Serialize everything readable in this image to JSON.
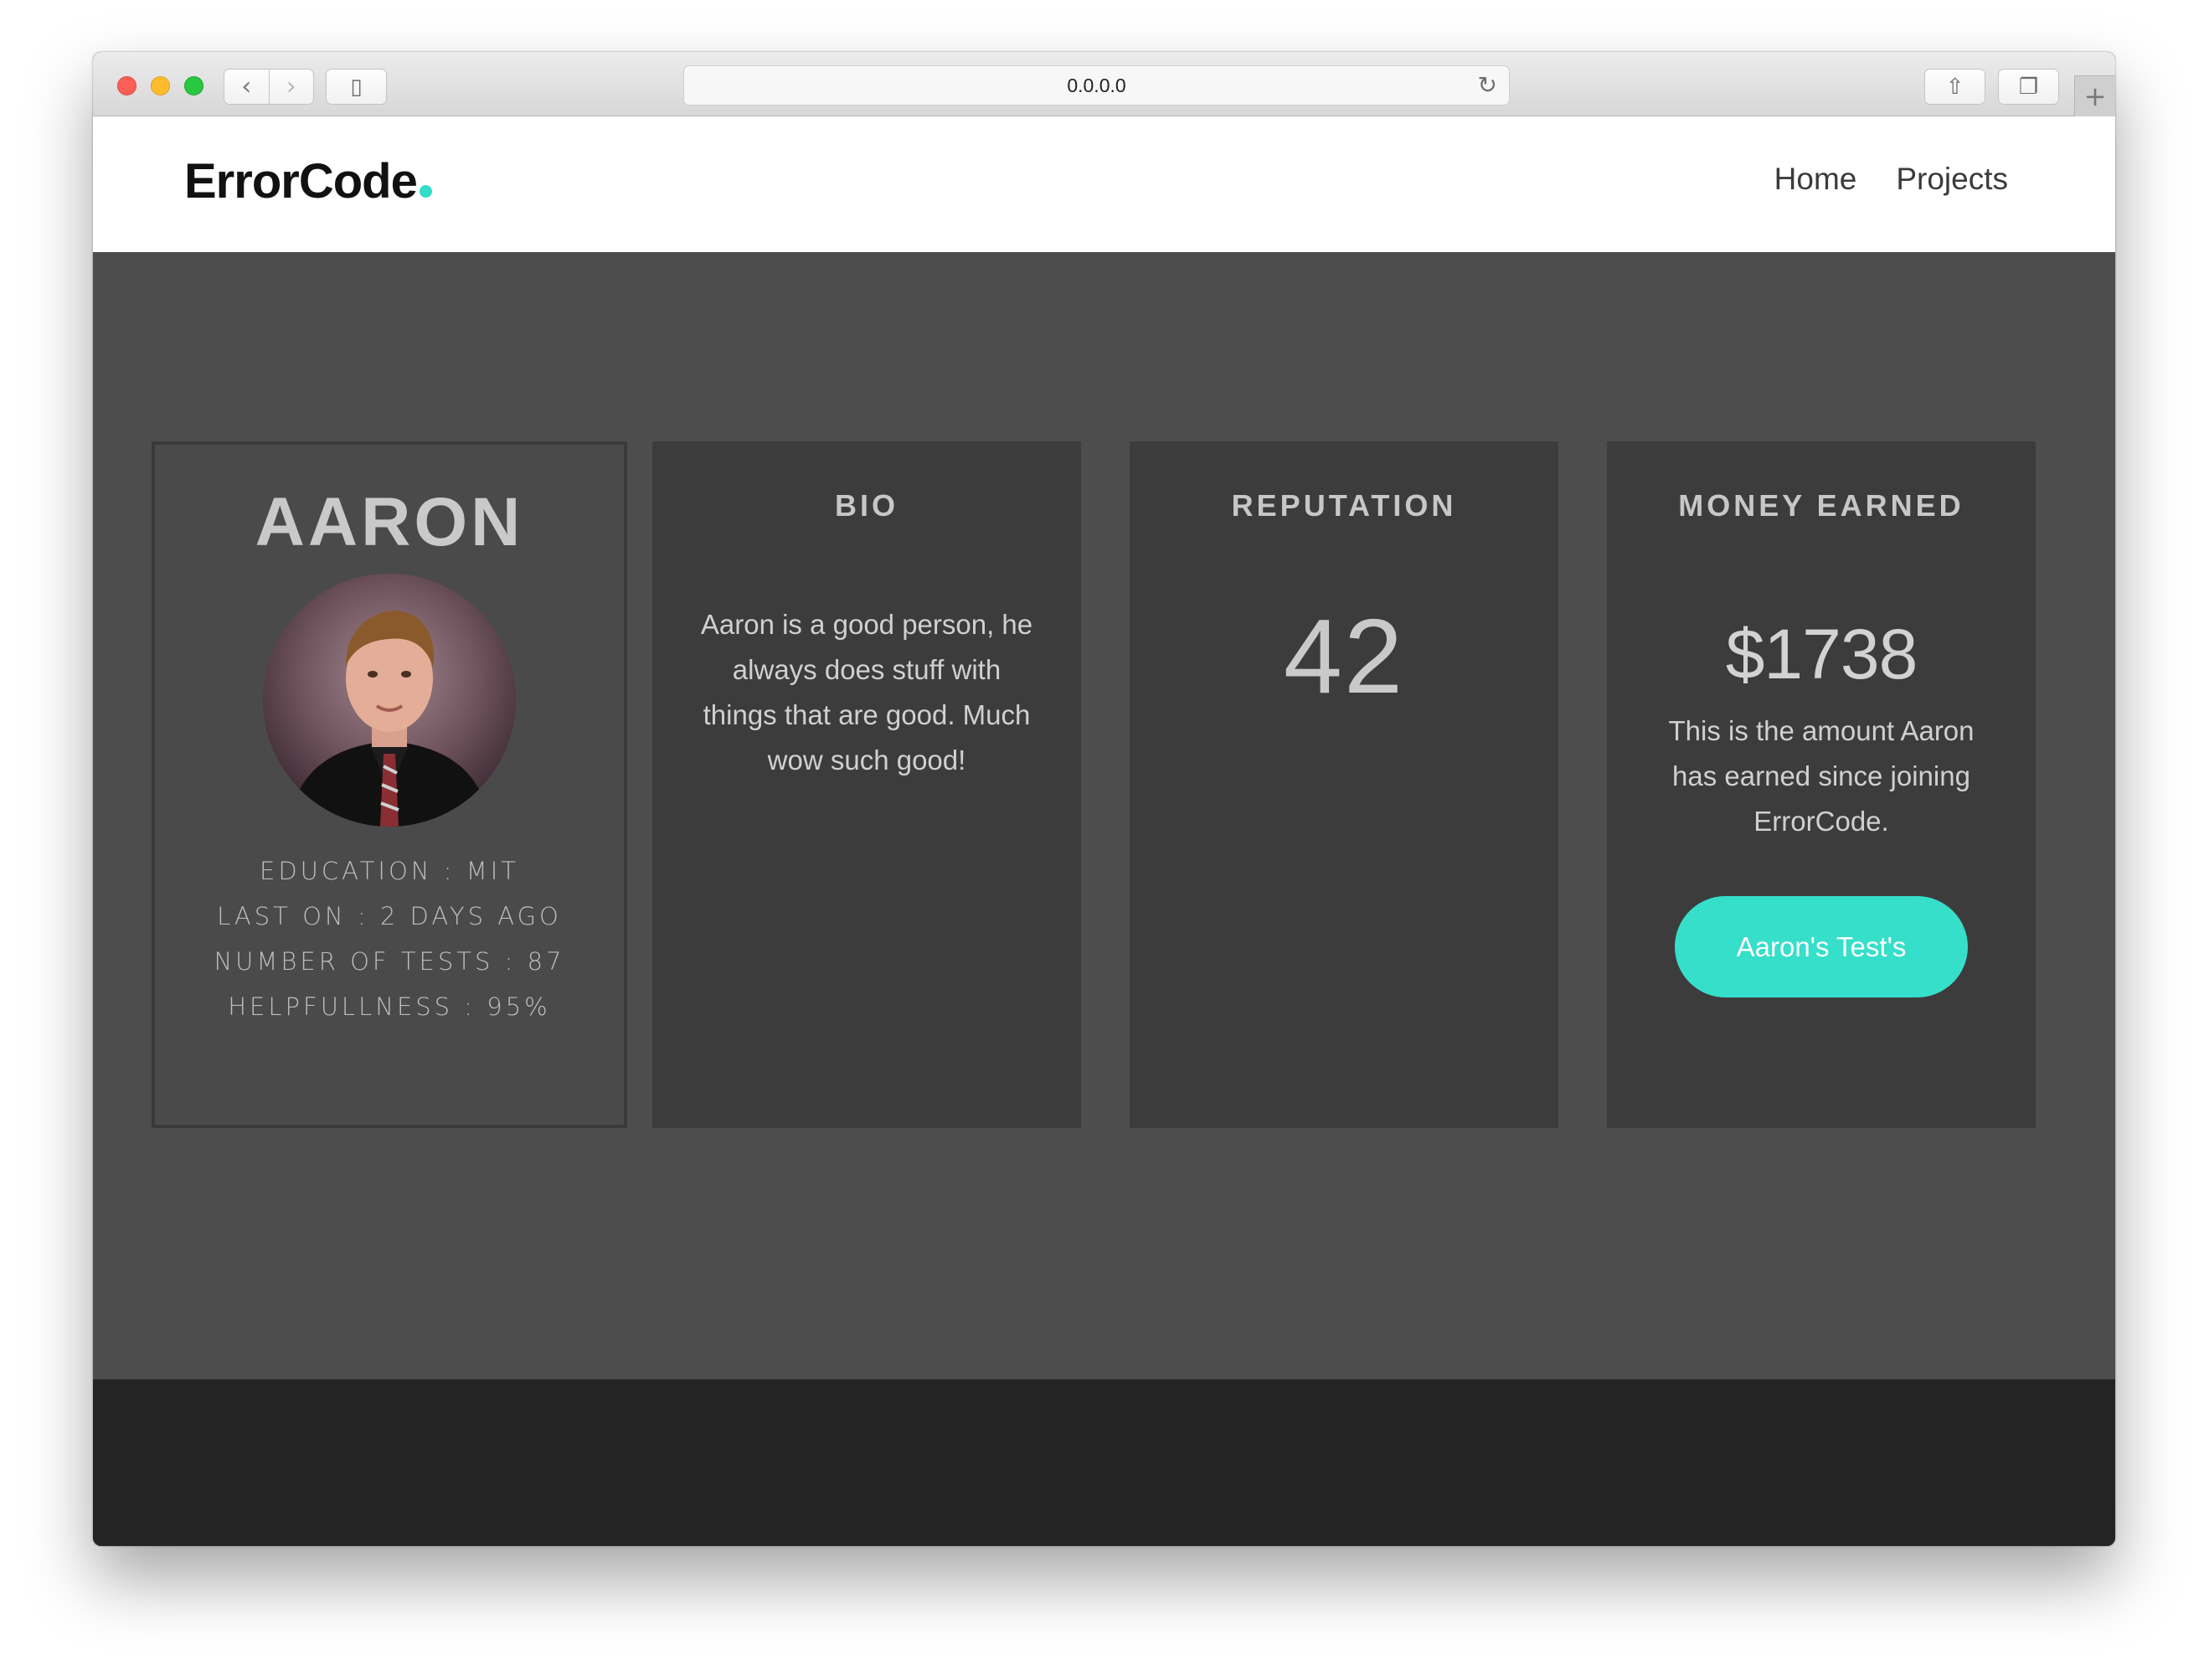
{
  "browser": {
    "url": "0.0.0.0",
    "back_icon": "‹",
    "forward_icon": "›",
    "reload_icon": "↻",
    "share_icon": "⇧",
    "tabs_icon": "❐",
    "sidebar_icon": "▯",
    "newtab_icon": "+"
  },
  "header": {
    "logo_text": "ErrorCode",
    "nav": [
      {
        "label": "Home"
      },
      {
        "label": "Projects"
      }
    ]
  },
  "profile": {
    "name": "AARON",
    "stats": [
      "EDUCATION : MIT",
      "LAST ON : 2 DAYS AGO",
      "NUMBER OF TESTS : 87",
      "HELPFULLNESS : 95%"
    ]
  },
  "bio": {
    "title": "BIO",
    "text": "Aaron is a good person, he always does stuff with things that are good. Much wow such good!"
  },
  "reputation": {
    "title": "REPUTATION",
    "value": "42"
  },
  "money": {
    "title": "MONEY EARNED",
    "value": "$1738",
    "description": "This is the amount Aaron has earned since joining ErrorCode.",
    "button_label": "Aaron's Test's"
  },
  "colors": {
    "accent": "#35dfca",
    "main_bg": "#4d4d4d",
    "card_bg": "#3c3c3c",
    "footer_bg": "#242424"
  }
}
